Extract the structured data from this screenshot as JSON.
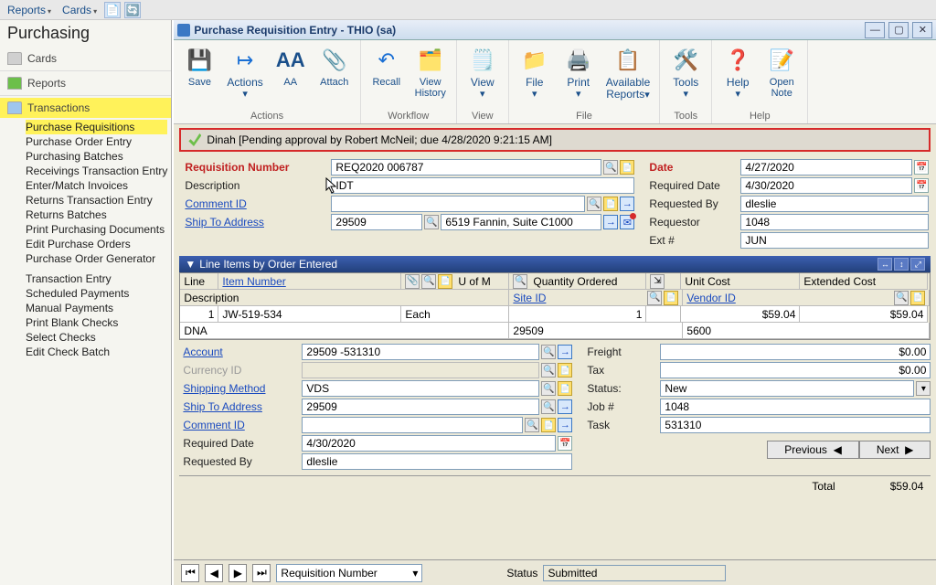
{
  "top_menu": {
    "reports": "Reports",
    "cards": "Cards"
  },
  "nav": {
    "title": "Purchasing",
    "groups": {
      "cards": "Cards",
      "reports": "Reports",
      "transactions": "Transactions"
    },
    "items": [
      "Purchase Requisitions",
      "Purchase Order Entry",
      "Purchasing Batches",
      "Receivings Transaction Entry",
      "Enter/Match Invoices",
      "Returns Transaction Entry",
      "Returns Batches",
      "Print Purchasing Documents",
      "Edit Purchase Orders",
      "Purchase Order Generator",
      "Transaction Entry",
      "Scheduled Payments",
      "Manual Payments",
      "Print Blank Checks",
      "Select Checks",
      "Edit Check Batch"
    ]
  },
  "window_title": "Purchase Requisition Entry  -  THIO (sa)",
  "ribbon": {
    "save": "Save",
    "actions": "Actions",
    "aa": "AA",
    "attach": "Attach",
    "recall": "Recall",
    "view_history": "View\nHistory",
    "view": "View",
    "file": "File",
    "print": "Print",
    "available_reports": "Available\nReports",
    "tools": "Tools",
    "help": "Help",
    "open_note": "Open\nNote",
    "g_actions": "Actions",
    "g_workflow": "Workflow",
    "g_view": "View",
    "g_file": "File",
    "g_tools": "Tools",
    "g_help": "Help"
  },
  "approval_text": "Dinah [Pending approval by Robert McNeil; due 4/28/2020 9:21:15 AM]",
  "header": {
    "requisition_number_label": "Requisition Number",
    "requisition_number": "REQ2020 006787",
    "description_label": "Description",
    "description": "IDT",
    "comment_id_label": "Comment ID",
    "comment_id": "",
    "ship_to_label": "Ship To Address",
    "ship_to": "29509",
    "ship_to_text": "6519 Fannin, Suite C1000",
    "date_label": "Date",
    "date": "4/27/2020",
    "required_date_label": "Required Date",
    "required_date": "4/30/2020",
    "requested_by_label": "Requested By",
    "requested_by": "dleslie",
    "requestor_label": "Requestor",
    "requestor": "1048",
    "ext_label": "Ext #",
    "ext": "JUN"
  },
  "grid": {
    "title": "Line Items by Order Entered",
    "cols": {
      "line": "Line",
      "item": "Item Number",
      "uofm": "U of M",
      "qty": "Quantity Ordered",
      "unit": "Unit Cost",
      "ext": "Extended Cost",
      "desc": "Description",
      "site": "Site ID",
      "vendor": "Vendor ID"
    },
    "row": {
      "line": "1",
      "item": "JW-519-534",
      "uofm": "Each",
      "qty": "1",
      "unit": "$59.04",
      "ext": "$59.04",
      "desc": "DNA",
      "site": "29509",
      "vendor": "5600"
    }
  },
  "detail": {
    "account_label": "Account",
    "account": "29509 -531310",
    "currency_label": "Currency ID",
    "currency": "",
    "shipping_method_label": "Shipping Method",
    "shipping_method": "VDS",
    "ship_to_label": "Ship To Address",
    "ship_to": "29509",
    "comment_id_label": "Comment ID",
    "comment_id": "",
    "required_date_label": "Required Date",
    "required_date": "4/30/2020",
    "requested_by_label": "Requested By",
    "requested_by": "dleslie",
    "freight_label": "Freight",
    "freight": "$0.00",
    "tax_label": "Tax",
    "tax": "$0.00",
    "status_label": "Status:",
    "status": "New",
    "job_label": "Job #",
    "job": "1048",
    "task_label": "Task",
    "task": "531310",
    "previous": "Previous",
    "next": "Next",
    "total_label": "Total",
    "total": "$59.04"
  },
  "footer": {
    "sort_by": "Requisition Number",
    "status_label": "Status",
    "status": "Submitted"
  }
}
